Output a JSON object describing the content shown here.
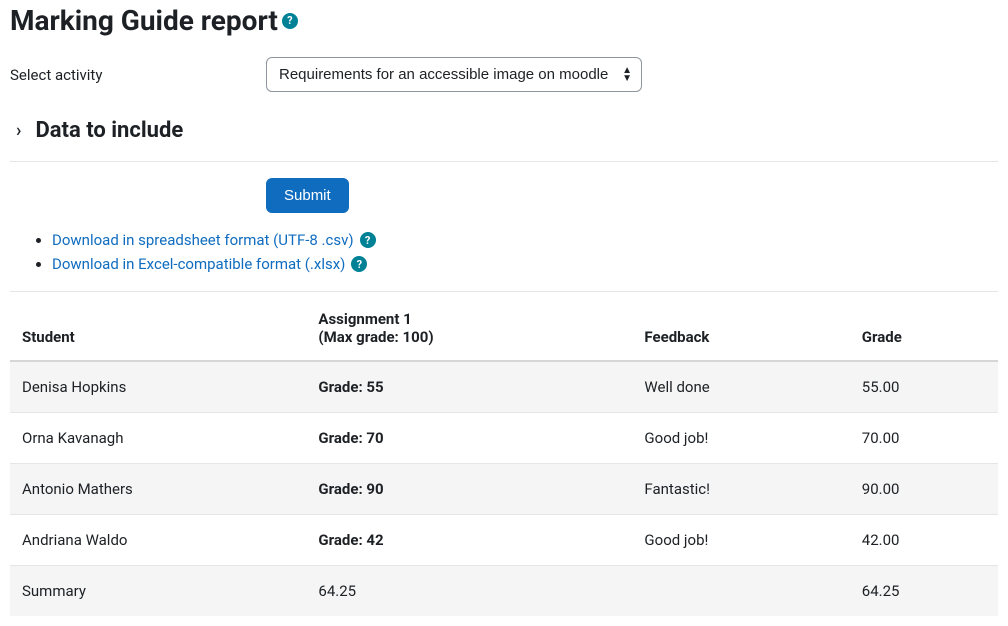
{
  "page_title": "Marking Guide report",
  "select_label": "Select activity",
  "activity_select": {
    "selected": "Requirements for an accessible image on moodle"
  },
  "data_to_include_heading": "Data to include",
  "submit_label": "Submit",
  "downloads": {
    "csv_label": "Download in spreadsheet format (UTF-8 .csv)",
    "xlsx_label": "Download in Excel-compatible format (.xlsx)"
  },
  "table": {
    "headers": {
      "student": "Student",
      "assignment_line1": "Assignment 1",
      "assignment_line2": "(Max grade: 100)",
      "feedback": "Feedback",
      "grade": "Grade"
    },
    "rows": [
      {
        "student": "Denisa Hopkins",
        "assign": "Grade: 55",
        "feedback": "Well done",
        "grade": "55.00"
      },
      {
        "student": "Orna Kavanagh",
        "assign": "Grade: 70",
        "feedback": "Good job!",
        "grade": "70.00"
      },
      {
        "student": "Antonio Mathers",
        "assign": "Grade: 90",
        "feedback": "Fantastic!",
        "grade": "90.00"
      },
      {
        "student": "Andriana Waldo",
        "assign": "Grade: 42",
        "feedback": "Good job!",
        "grade": "42.00"
      }
    ],
    "summary": {
      "student": "Summary",
      "assign": "64.25",
      "feedback": "",
      "grade": "64.25"
    }
  }
}
